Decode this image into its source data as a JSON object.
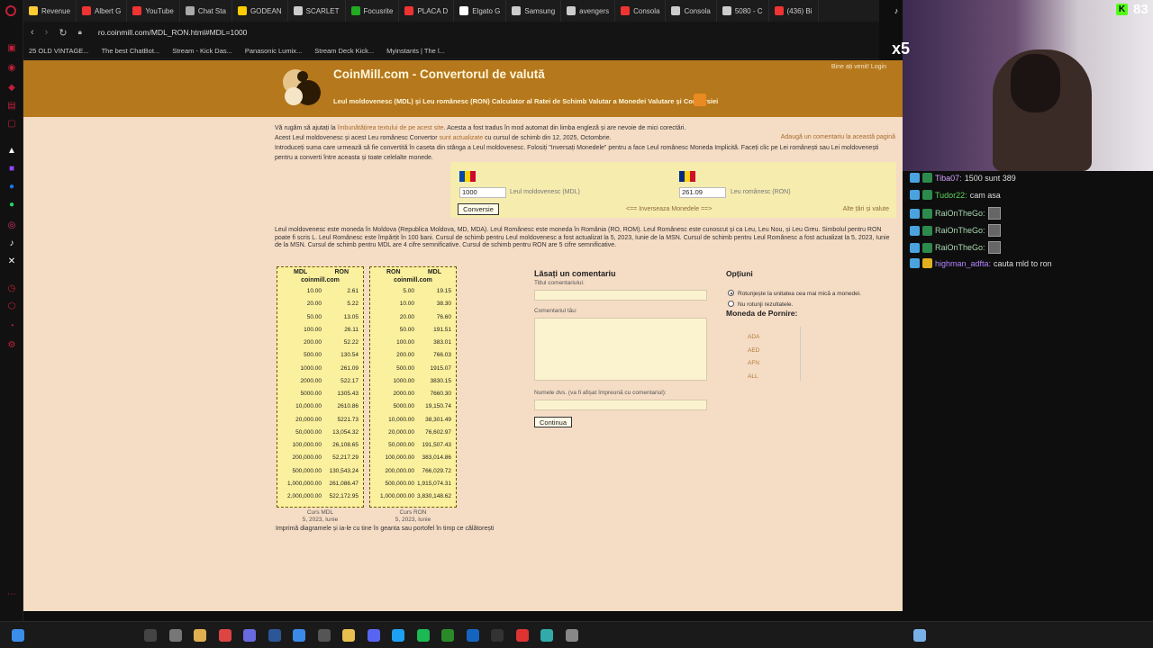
{
  "browser": {
    "tabs": [
      "Revenue",
      "Albert G",
      "YouTube",
      "Chat Sta",
      "GODEAN",
      "SCARLET",
      "Focusrite",
      "PLACA D",
      "Elgato G",
      "Samsung",
      "avengers",
      "Consola",
      "Consola",
      "5080 - C",
      "(436) Bi"
    ],
    "tab_colors": [
      "#ffcc33",
      "#e33",
      "#e33",
      "#aaa",
      "#ffcc00",
      "#ccc",
      "#2a2",
      "#e33",
      "#fff",
      "#ccc",
      "#ccc",
      "#e33",
      "#ccc",
      "#ccc",
      "#e33"
    ],
    "url": "ro.coinmill.com/MDL_RON.html#MDL=1000",
    "bookmarks": [
      "25 OLD VINTAGE...",
      "The best ChatBot...",
      "Stream - Kick Das...",
      "Panasonic Lumix...",
      "Stream Deck Kick...",
      "Myinstants | The l..."
    ]
  },
  "header": {
    "title": "CoinMill.com - Convertorul de valută",
    "subtitle": "Leul moldovenesc (MDL) şi Leu românesc (RON) Calculator al Ratei de Schimb Valutar a Monedei Valutare și Conversiei",
    "welcome": "Bine ați venit! Login"
  },
  "intro": {
    "line1_a": "Vă rugăm să ajutați la ",
    "line1_link": "îmbunătățirea textului de pe acest site",
    "line1_b": ". Acesta a fost tradus în mod automat din limba engleză și are nevoie de mici corectări.",
    "line2_a": "Acest Leul moldovenesc și acest Leu românesc Convertor ",
    "line2_link": "sunt actualizate",
    "line2_b": " cu cursul de schimb din 12, 2025, Octombrie.",
    "line3": "Introduceți suma care urmează să fie convertită în caseta din stânga a Leul moldovenesc. Folosiți \"Inversați Monedele\" pentru a face Leul românesc Moneda Implicită. Faceți clic pe Lei românești sau Lei moldovenești pentru a converti între aceasta și toate celelalte monede.",
    "add_comment": "Adaugă un comentariu la această pagină"
  },
  "converter": {
    "from_value": "1000",
    "from_label": "Leul moldovenesc (MDL)",
    "to_value": "261.09",
    "to_label": "Leu românesc (RON)",
    "convert_btn": "Conversie",
    "swap_link": "<== Inverseaza Monedele ==>",
    "other_link": "Alte țări și valute"
  },
  "description": "Leul moldovenesc este moneda în Moldova (Republica Moldova, MD, MDA). Leul Românesc este moneda în România (RO, ROM). Leul Românesc este cunoscut și ca Leu, Leu Nou, și Leu Greu. Simbolul pentru RON poate fi scris L. Leul Românesc este împărțit în 100 bani. Cursul de schimb pentru Leul moldovenesc a fost actualizat la 5, 2023, Iunie de la MSN. Cursul de schimb pentru Leul Românesc a fost actualizat la 5, 2023, Iunie de la MSN. Cursul de schimb pentru MDL are 4 cifre semnificative. Cursul de schimb pentru RON are 5 cifre semnificative.",
  "table_mdl": {
    "h1": "MDL",
    "h2": "RON",
    "site": "coinmill.com",
    "rows": [
      [
        "10.00",
        "2.61"
      ],
      [
        "20.00",
        "5.22"
      ],
      [
        "50.00",
        "13.05"
      ],
      [
        "100.00",
        "26.11"
      ],
      [
        "200.00",
        "52.22"
      ],
      [
        "500.00",
        "130.54"
      ],
      [
        "1000.00",
        "261.09"
      ],
      [
        "2000.00",
        "522.17"
      ],
      [
        "5000.00",
        "1305.43"
      ],
      [
        "10,000.00",
        "2610.86"
      ],
      [
        "20,000.00",
        "5221.73"
      ],
      [
        "50,000.00",
        "13,054.32"
      ],
      [
        "100,000.00",
        "26,108.65"
      ],
      [
        "200,000.00",
        "52,217.29"
      ],
      [
        "500,000.00",
        "130,543.24"
      ],
      [
        "1,000,000.00",
        "261,086.47"
      ],
      [
        "2,000,000.00",
        "522,172.95"
      ]
    ],
    "foot1": "Curs MDL",
    "foot2": "5, 2023, Iunie"
  },
  "table_ron": {
    "h1": "RON",
    "h2": "MDL",
    "site": "coinmill.com",
    "rows": [
      [
        "5.00",
        "19.15"
      ],
      [
        "10.00",
        "38.30"
      ],
      [
        "20.00",
        "76.60"
      ],
      [
        "50.00",
        "191.51"
      ],
      [
        "100.00",
        "383.01"
      ],
      [
        "200.00",
        "766.03"
      ],
      [
        "500.00",
        "1915.07"
      ],
      [
        "1000.00",
        "3830.15"
      ],
      [
        "2000.00",
        "7660.30"
      ],
      [
        "5000.00",
        "19,150.74"
      ],
      [
        "10,000.00",
        "38,301.49"
      ],
      [
        "20,000.00",
        "76,602.97"
      ],
      [
        "50,000.00",
        "191,507.43"
      ],
      [
        "100,000.00",
        "383,014.86"
      ],
      [
        "200,000.00",
        "766,029.72"
      ],
      [
        "500,000.00",
        "1,915,074.31"
      ],
      [
        "1,000,000.00",
        "3,830,148.62"
      ]
    ],
    "foot1": "Curs RON",
    "foot2": "5, 2023, Iunie"
  },
  "print_text": "Imprimă diagramele și ia-le cu tine în geanta sau portofel în timp ce călătorești",
  "comment": {
    "title": "Lăsați un comentariu",
    "title_label": "Titlul comentariului:",
    "body_label": "Comentariul tău:",
    "name_label": "Numele dvs. (va fi afișat împreună cu comentariul):",
    "submit": "Continua"
  },
  "options": {
    "title": "Opțiuni",
    "opt1": "Rotunjește la unitatea cea mai mică a monedei.",
    "opt2": "Nu rotunji rezultatele.",
    "start_title": "Moneda de Pornire:",
    "currencies": [
      "ADA",
      "AED",
      "AFN",
      "ALL"
    ]
  },
  "stream": {
    "follower_count": "83",
    "multiplier": "x5",
    "chat": [
      {
        "user": "Tiba07:",
        "msg": "1500 sunt 389",
        "color": "#d6a4ff"
      },
      {
        "user": "Tudor22:",
        "msg": "cam asa",
        "color": "#5cd65c"
      },
      {
        "user": "RaiOnTheGo:",
        "msg": "",
        "color": "#a8d8b0"
      },
      {
        "user": "RaiOnTheGo:",
        "msg": "",
        "color": "#a8d8b0"
      },
      {
        "user": "RaiOnTheGo:",
        "msg": "",
        "color": "#a8d8b0"
      },
      {
        "user": "highman_adfta:",
        "msg": "cauta mld to ron",
        "color": "#b084ff"
      }
    ]
  }
}
